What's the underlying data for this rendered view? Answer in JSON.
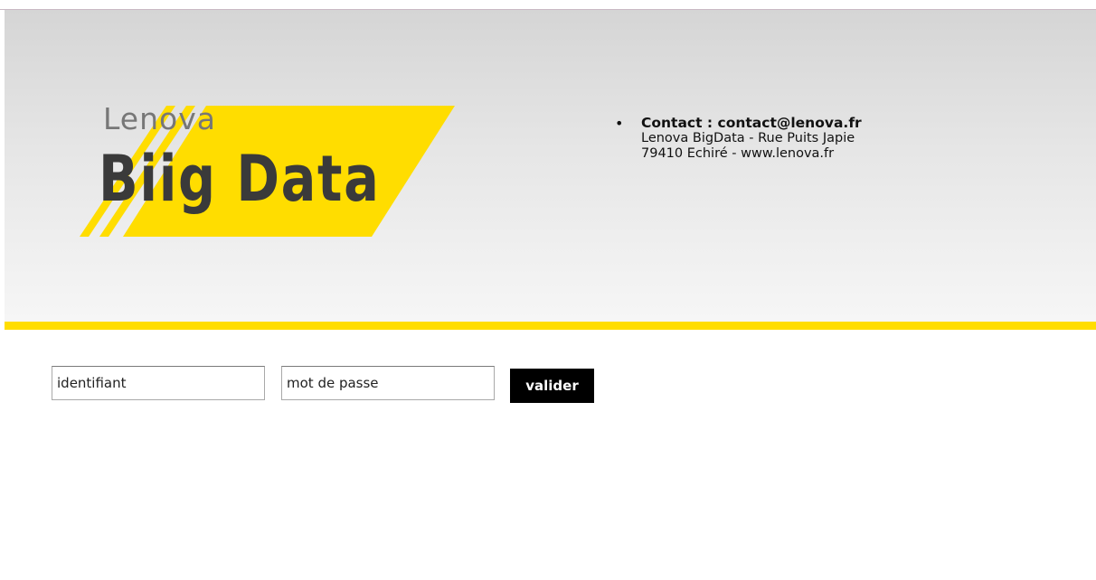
{
  "logo": {
    "small_text": "Lenova",
    "big_text": "Biig Data",
    "colors": {
      "stripe": "#ffdd00",
      "text": "#3a3a3a"
    }
  },
  "contact": {
    "title": "Contact : contact@lenova.fr",
    "line1": "Lenova BigData - Rue Puits Japie",
    "line2": "79410 Echiré - www.lenova.fr"
  },
  "login_form": {
    "username_value": "identifiant",
    "password_value": "mot de passe",
    "submit_label": "valider"
  },
  "colors": {
    "accent": "#ffdd00",
    "header_gradient_top": "#d5d5d5",
    "header_gradient_bottom": "#f6f6f6",
    "button": "#000000"
  }
}
